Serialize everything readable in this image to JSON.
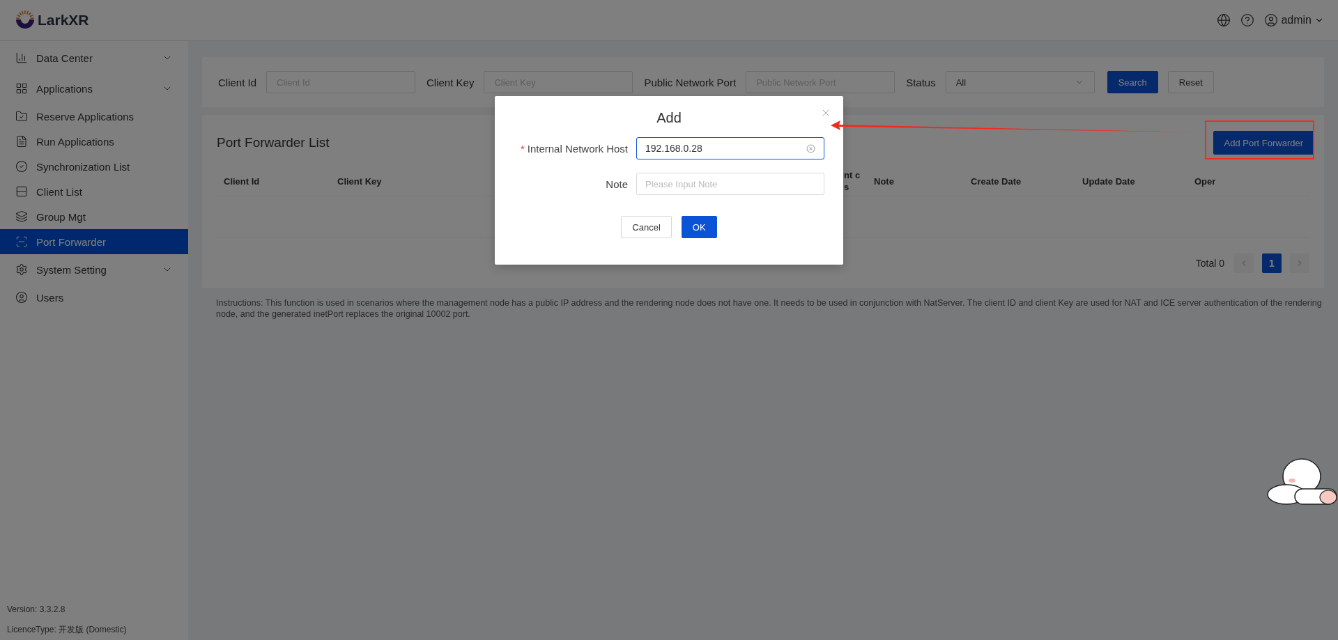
{
  "header": {
    "logo": "LarkXR",
    "user": "admin"
  },
  "sidebar": {
    "items": [
      {
        "label": "Data Center",
        "expandable": true,
        "selected": false
      },
      {
        "label": "Applications",
        "expandable": true,
        "selected": false
      },
      {
        "label": "Reserve Applications",
        "expandable": false,
        "selected": false
      },
      {
        "label": "Run Applications",
        "expandable": false,
        "selected": false
      },
      {
        "label": "Synchronization List",
        "expandable": false,
        "selected": false
      },
      {
        "label": "Client List",
        "expandable": false,
        "selected": false
      },
      {
        "label": "Group Mgt",
        "expandable": false,
        "selected": false
      },
      {
        "label": "Port Forwarder",
        "expandable": false,
        "selected": true
      },
      {
        "label": "System Setting",
        "expandable": true,
        "selected": false
      },
      {
        "label": "Users",
        "expandable": false,
        "selected": false
      }
    ],
    "version": "Version: 3.3.2.8",
    "licence": "LicenceType: 开发版 (Domestic)"
  },
  "filters": {
    "fields": [
      {
        "kind": "input",
        "label": "Client Id",
        "placeholder": "Client Id"
      },
      {
        "kind": "input",
        "label": "Client Key",
        "placeholder": "Client Key"
      },
      {
        "kind": "input",
        "label": "Public Network Port",
        "placeholder": "Public Network Port"
      },
      {
        "kind": "select",
        "label": "Status",
        "value": "All"
      }
    ],
    "buttons": [
      {
        "kind": "primary",
        "label": "Search"
      },
      {
        "kind": "default",
        "label": "Reset"
      }
    ]
  },
  "list": {
    "title": "Port Forwarder List",
    "add_button": "Add Port Forwarder",
    "columns": [
      {
        "lines": [
          "Client Id"
        ]
      },
      {
        "lines": [
          "Client Key"
        ]
      },
      {
        "lines": [
          "nt c",
          "s"
        ]
      },
      {
        "lines": [
          "Note"
        ]
      },
      {
        "lines": [
          "Create Date"
        ]
      },
      {
        "lines": [
          "Update Date"
        ]
      },
      {
        "lines": [
          "Oper"
        ]
      }
    ],
    "total": "Total 0",
    "pages": [
      {
        "label": "1",
        "selected": true
      }
    ]
  },
  "instructions": "Instructions: This function is used in scenarios where the management node has a public IP address and the rendering node does not have one. It needs to be used in conjunction with NatServer. The client ID and client Key are used for NAT and ICE server authentication of the rendering node, and the generated inetPort replaces the original 10002 port.",
  "dialog": {
    "title": "Add",
    "fields": [
      {
        "required_mark": "*",
        "label": "Internal Network Host",
        "value": "192.168.0.28",
        "focused": true
      },
      {
        "label": "Note",
        "placeholder": "Please Input Note",
        "focused": false
      }
    ],
    "buttons": [
      {
        "kind": "default",
        "label": "Cancel"
      },
      {
        "kind": "primary",
        "label": "OK"
      }
    ]
  }
}
